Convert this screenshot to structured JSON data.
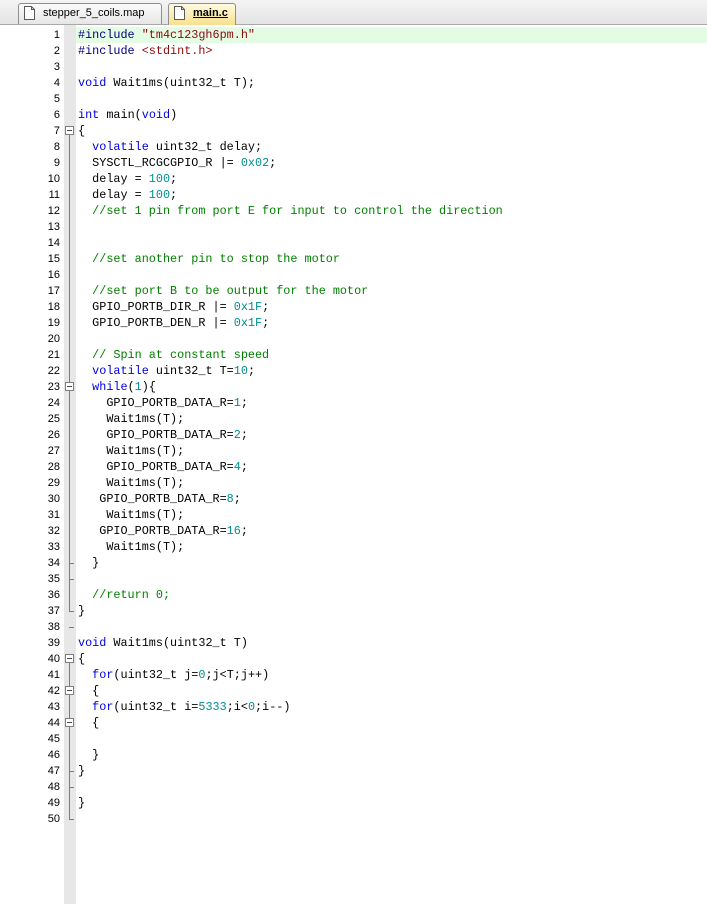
{
  "tabs": [
    {
      "label": "stepper_5_coils.map",
      "active": false
    },
    {
      "label": "main.c",
      "active": true
    }
  ],
  "colors": {
    "string": "#8b0a0a",
    "keyword": "#0000e0",
    "number": "#008e8e",
    "comment": "#008000",
    "current_line": "#e4fce4",
    "active_tab": "#f7e08c"
  },
  "editor": {
    "current_line": 1,
    "lines": [
      [
        [
          "p",
          "#include "
        ],
        [
          "s",
          "\"tm4c123gh6pm.h\""
        ]
      ],
      [
        [
          "p",
          "#include "
        ],
        [
          "s",
          "<stdint.h>"
        ]
      ],
      [],
      [
        [
          "k",
          "void"
        ],
        [
          "t",
          " Wait1ms(uint32_t T);"
        ]
      ],
      [],
      [
        [
          "k",
          "int"
        ],
        [
          "t",
          " main("
        ],
        [
          "k",
          "void"
        ],
        [
          "t",
          ")"
        ]
      ],
      [
        [
          "t",
          "{"
        ]
      ],
      [
        [
          "t",
          "  "
        ],
        [
          "k",
          "volatile"
        ],
        [
          "t",
          " uint32_t delay;"
        ]
      ],
      [
        [
          "t",
          "  SYSCTL_RCGCGPIO_R |= "
        ],
        [
          "n",
          "0x02"
        ],
        [
          "t",
          ";"
        ]
      ],
      [
        [
          "t",
          "  delay = "
        ],
        [
          "n",
          "100"
        ],
        [
          "t",
          ";"
        ]
      ],
      [
        [
          "t",
          "  delay = "
        ],
        [
          "n",
          "100"
        ],
        [
          "t",
          ";"
        ]
      ],
      [
        [
          "c",
          "  //set 1 pin from port E for input to control the direction"
        ]
      ],
      [],
      [],
      [
        [
          "c",
          "  //set another pin to stop the motor"
        ]
      ],
      [],
      [
        [
          "c",
          "  //set port B to be output for the motor"
        ]
      ],
      [
        [
          "t",
          "  GPIO_PORTB_DIR_R |= "
        ],
        [
          "n",
          "0x1F"
        ],
        [
          "t",
          ";"
        ]
      ],
      [
        [
          "t",
          "  GPIO_PORTB_DEN_R |= "
        ],
        [
          "n",
          "0x1F"
        ],
        [
          "t",
          ";"
        ]
      ],
      [],
      [
        [
          "c",
          "  // Spin at constant speed"
        ]
      ],
      [
        [
          "t",
          "  "
        ],
        [
          "k",
          "volatile"
        ],
        [
          "t",
          " uint32_t T="
        ],
        [
          "n",
          "10"
        ],
        [
          "t",
          ";"
        ]
      ],
      [
        [
          "t",
          "  "
        ],
        [
          "k",
          "while"
        ],
        [
          "t",
          "("
        ],
        [
          "n",
          "1"
        ],
        [
          "t",
          "){"
        ]
      ],
      [
        [
          "t",
          "    GPIO_PORTB_DATA_R="
        ],
        [
          "n",
          "1"
        ],
        [
          "t",
          ";"
        ]
      ],
      [
        [
          "t",
          "    Wait1ms(T);"
        ]
      ],
      [
        [
          "t",
          "    GPIO_PORTB_DATA_R="
        ],
        [
          "n",
          "2"
        ],
        [
          "t",
          ";"
        ]
      ],
      [
        [
          "t",
          "    Wait1ms(T);"
        ]
      ],
      [
        [
          "t",
          "    GPIO_PORTB_DATA_R="
        ],
        [
          "n",
          "4"
        ],
        [
          "t",
          ";"
        ]
      ],
      [
        [
          "t",
          "    Wait1ms(T);"
        ]
      ],
      [
        [
          "t",
          "   GPIO_PORTB_DATA_R="
        ],
        [
          "n",
          "8"
        ],
        [
          "t",
          ";"
        ]
      ],
      [
        [
          "t",
          "    Wait1ms(T);"
        ]
      ],
      [
        [
          "t",
          "   GPIO_PORTB_DATA_R="
        ],
        [
          "n",
          "16"
        ],
        [
          "t",
          ";"
        ]
      ],
      [
        [
          "t",
          "    Wait1ms(T);"
        ]
      ],
      [
        [
          "t",
          "  }"
        ]
      ],
      [],
      [
        [
          "c",
          "  //return 0;"
        ]
      ],
      [
        [
          "t",
          "}"
        ]
      ],
      [],
      [
        [
          "k",
          "void"
        ],
        [
          "t",
          " Wait1ms(uint32_t T)"
        ]
      ],
      [
        [
          "t",
          "{"
        ]
      ],
      [
        [
          "t",
          "  "
        ],
        [
          "k",
          "for"
        ],
        [
          "t",
          "(uint32_t j="
        ],
        [
          "n",
          "0"
        ],
        [
          "t",
          ";j<T;j++)"
        ]
      ],
      [
        [
          "t",
          "  {"
        ]
      ],
      [
        [
          "t",
          "  "
        ],
        [
          "k",
          "for"
        ],
        [
          "t",
          "(uint32_t i="
        ],
        [
          "n",
          "5333"
        ],
        [
          "t",
          ";i<"
        ],
        [
          "n",
          "0"
        ],
        [
          "t",
          ";i--)"
        ]
      ],
      [
        [
          "t",
          "  {"
        ]
      ],
      [],
      [
        [
          "t",
          "  }"
        ]
      ],
      [
        [
          "t",
          "}"
        ]
      ],
      [],
      [
        [
          "t",
          "}"
        ]
      ],
      []
    ]
  }
}
